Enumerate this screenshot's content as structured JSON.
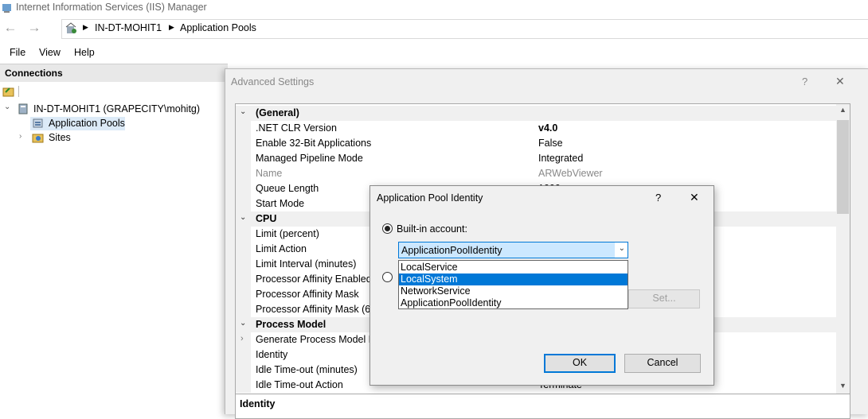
{
  "window": {
    "title": "Internet Information Services (IIS) Manager"
  },
  "nav": {
    "back_icon": "arrow-left-icon",
    "forward_icon": "arrow-right-icon",
    "breadcrumb": [
      "IN-DT-MOHIT1",
      "Application Pools"
    ]
  },
  "menu": {
    "items": [
      "File",
      "View",
      "Help"
    ]
  },
  "connections": {
    "header": "Connections",
    "tree": [
      {
        "label": "IN-DT-MOHIT1 (GRAPECITY\\mohitg)",
        "level": 0,
        "expanded": true
      },
      {
        "label": "Application Pools",
        "level": 1,
        "selected": true
      },
      {
        "label": "Sites",
        "level": 1,
        "expanded": false
      }
    ]
  },
  "advanced": {
    "title": "Advanced Settings",
    "help": "?",
    "close": "✕",
    "sections": {
      "general": "(General)",
      "cpu": "CPU",
      "process_model": "Process Model"
    },
    "rows": {
      "clr_name": ".NET CLR Version",
      "clr_val": "v4.0",
      "bit32_name": "Enable 32-Bit Applications",
      "bit32_val": "False",
      "pipeline_name": "Managed Pipeline Mode",
      "pipeline_val": "Integrated",
      "name_name": "Name",
      "name_val": "ARWebViewer",
      "queue_name": "Queue Length",
      "queue_val": "1000",
      "start_name": "Start Mode",
      "limit_name": "Limit (percent)",
      "limitaction_name": "Limit Action",
      "limitinterval_name": "Limit Interval (minutes)",
      "affinity_name": "Processor Affinity Enabled",
      "mask_name": "Processor Affinity Mask",
      "mask64_name": "Processor Affinity Mask (64",
      "genproc_name": "Generate Process Model Eve",
      "identity_name": "Identity",
      "idle_name": "Idle Time-out (minutes)",
      "idleaction_name": "Idle Time-out Action",
      "idleaction_val": "Terminate"
    },
    "description_title": "Identity"
  },
  "identity_dialog": {
    "title": "Application Pool Identity",
    "help": "?",
    "close": "✕",
    "builtin_label": "Built-in account:",
    "combo_value": "ApplicationPoolIdentity",
    "options": [
      "LocalService",
      "LocalSystem",
      "NetworkService",
      "ApplicationPoolIdentity"
    ],
    "selected_option": "LocalSystem",
    "set_label": "Set...",
    "ok_label": "OK",
    "cancel_label": "Cancel"
  }
}
